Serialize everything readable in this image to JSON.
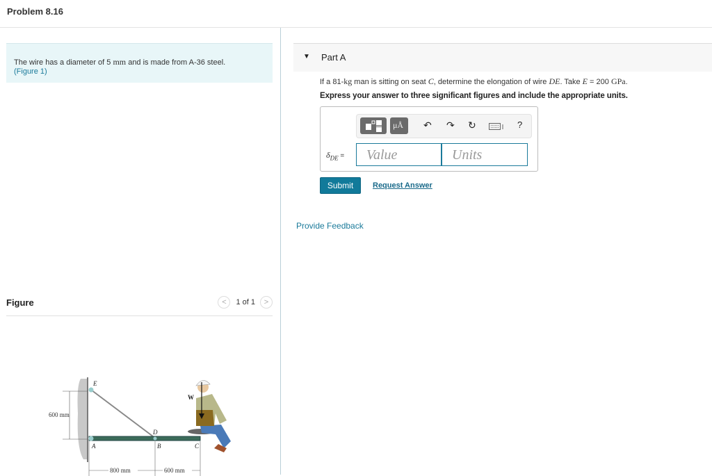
{
  "header": {
    "title": "Problem 8.16"
  },
  "intro": {
    "text_before": "The wire has a diameter of 5 ",
    "unit": "mm",
    "text_after": " and is made from A-36 steel.",
    "figure_link": "(Figure 1)"
  },
  "figure": {
    "label": "Figure",
    "prev_icon": "chevron-left-icon",
    "next_icon": "chevron-right-icon",
    "counter": "1 of 1",
    "labels": {
      "E": "E",
      "D": "D",
      "A": "A",
      "B": "B",
      "C": "C",
      "W": "W",
      "height": "600 mm",
      "span_ab": "800 mm",
      "span_bc": "600 mm"
    }
  },
  "part": {
    "caret": "▼",
    "label": "Part A",
    "question": {
      "t1": "If a 81-",
      "kg": "kg",
      "t2": " man is sitting on seat ",
      "C": "C",
      "t3": ", determine the elongation of wire ",
      "DE": "DE",
      "t4": ". Take ",
      "E": "E",
      "t5": " = 200 ",
      "GPa": "GPa",
      "t6": "."
    },
    "instruction": "Express your answer to three significant figures and include the appropriate units.",
    "toolbar": {
      "templates_icon": "templates-icon",
      "units_label": "μÅ",
      "undo_icon": "undo-icon",
      "redo_icon": "redo-icon",
      "reset_icon": "reset-icon",
      "keyboard_icon": "keyboard-icon",
      "help_label": "?"
    },
    "answer_label_delta": "δ",
    "answer_label_sub": "DE",
    "answer_label_eq": " =",
    "value_placeholder": "Value",
    "units_placeholder": "Units",
    "submit_label": "Submit",
    "request_label": "Request Answer"
  },
  "feedback_label": "Provide Feedback",
  "colors": {
    "accent": "#117a9a",
    "intro_bg": "#e8f6f8",
    "part_bg": "#f7f7f7"
  }
}
